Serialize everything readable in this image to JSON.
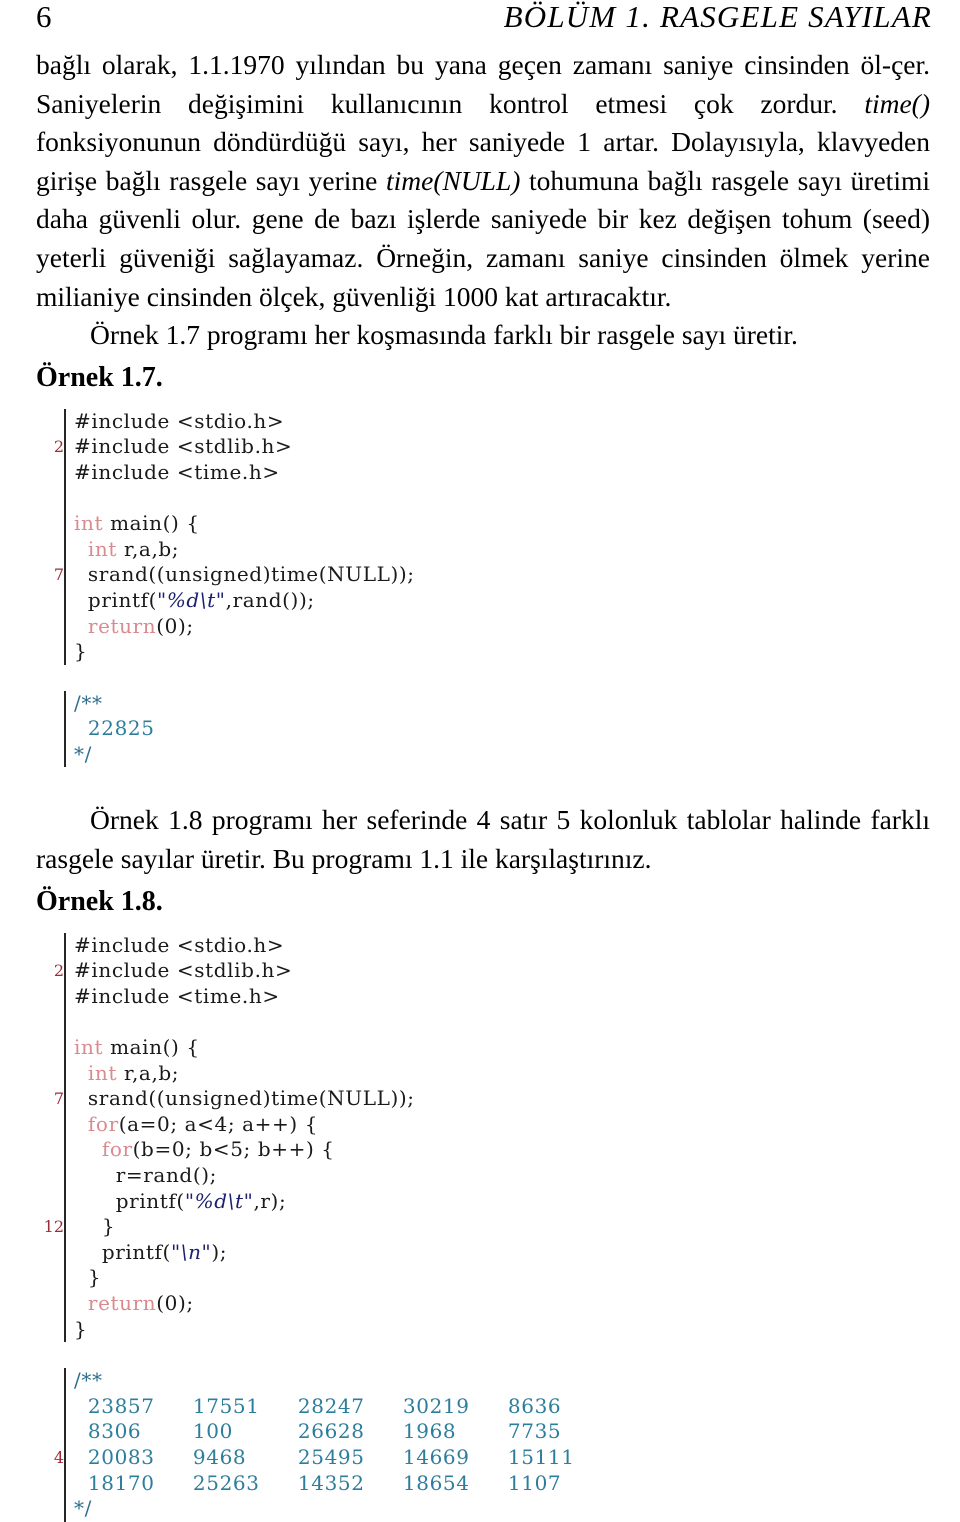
{
  "header": {
    "folio": "6",
    "chapter_title": "BÖLÜM 1.  RASGELE SAYILAR"
  },
  "paragraphs": {
    "p1_part1": "bağlı olarak, 1.1.1970 yılından bu yana geçen zamanı saniye cinsinden öl-çer. Saniyelerin değişimini kullanıcının kontrol etmesi çok zordur. ",
    "p1_time_italic": "time()",
    "p1_part2": " fonksiyonunun döndürdüğü sayı, her saniyede 1 artar. Dolayısıyla, klavyeden girişe bağlı rasgele sayı yerine ",
    "p1_timenull_italic": "time(NULL)",
    "p1_part3": " tohumuna bağlı rasgele sayı üretimi daha güvenli olur. gene de bazı işlerde saniyede bir kez değişen tohum (seed) yeterli güveniği sağlayamaz. Örneğin, zamanı saniye cinsinden ölmek yerine milianiye cinsinden ölçek, güvenliği 1000 kat artıracaktır.",
    "p2": "Örnek 1.7 programı her koşmasında farklı bir rasgele sayı üretir.",
    "p3": "Örnek 1.8 programı her seferinde 4 satır 5 kolonluk tablolar halinde farklı rasgele sayılar üretir. Bu programı 1.1 ile karşılaştırınız."
  },
  "example_1_7": {
    "heading": "Örnek 1.7.",
    "linenos": {
      "n2": "2",
      "n7": "7"
    },
    "code": {
      "inc_stdio": "#include <stdio.h>",
      "inc_stdlib": "#include <stdlib.h>",
      "inc_time": "#include <time.h>",
      "kw_int": "int",
      "main_open": " main() {",
      "kw_int2": "int",
      "decl_rab": " r,a,b;",
      "srand": "srand((unsigned)time(NULL));",
      "printf_open": "printf(",
      "printf_str": "\"%d\\t\"",
      "printf_rest": ",rand());",
      "kw_return": "return",
      "return_rest": "(0);",
      "brace_close": "}"
    },
    "output": {
      "comment_open": "/**",
      "value": "22825",
      "comment_close": "*/"
    }
  },
  "example_1_8": {
    "heading": "Örnek 1.8.",
    "linenos": {
      "n2": "2",
      "n7": "7",
      "n12": "12",
      "out4": "4"
    },
    "code": {
      "inc_stdio": "#include <stdio.h>",
      "inc_stdlib": "#include <stdlib.h>",
      "inc_time": "#include <time.h>",
      "kw_int": "int",
      "main_open": " main() {",
      "kw_int2": "int",
      "decl_rab": " r,a,b;",
      "srand": "srand((unsigned)time(NULL));",
      "kw_for_a": "for",
      "for_a_rest": "(a=0; a<4; a++) {",
      "kw_for_b": "for",
      "for_b_rest": "(b=0; b<5; b++) {",
      "assign_r": "r=rand();",
      "printf_open": "printf(",
      "printf_str": "\"%d\\t\"",
      "printf_rest": ",r);",
      "brace_inner": "}",
      "printf_nl_open": "printf(",
      "printf_nl_str": "\"\\n\"",
      "printf_nl_rest": ");",
      "brace_outer": "}",
      "kw_return": "return",
      "return_rest": "(0);",
      "brace_close": "}"
    },
    "output": {
      "comment_open": "/**",
      "comment_close": "*/",
      "rows": [
        [
          "23857",
          "17551",
          "28247",
          "30219",
          "8636"
        ],
        [
          "8306",
          "100",
          "26628",
          "1968",
          "7735"
        ],
        [
          "20083",
          "9468",
          "25495",
          "14669",
          "15111"
        ],
        [
          "18170",
          "25263",
          "14352",
          "18654",
          "1107"
        ]
      ]
    }
  },
  "colors": {
    "keyword": "#d98b8f",
    "string": "#1b1f6e",
    "comment": "#2d6e8e",
    "lineno": "#9e2b36",
    "rule": "#262626",
    "text": "#000000"
  }
}
